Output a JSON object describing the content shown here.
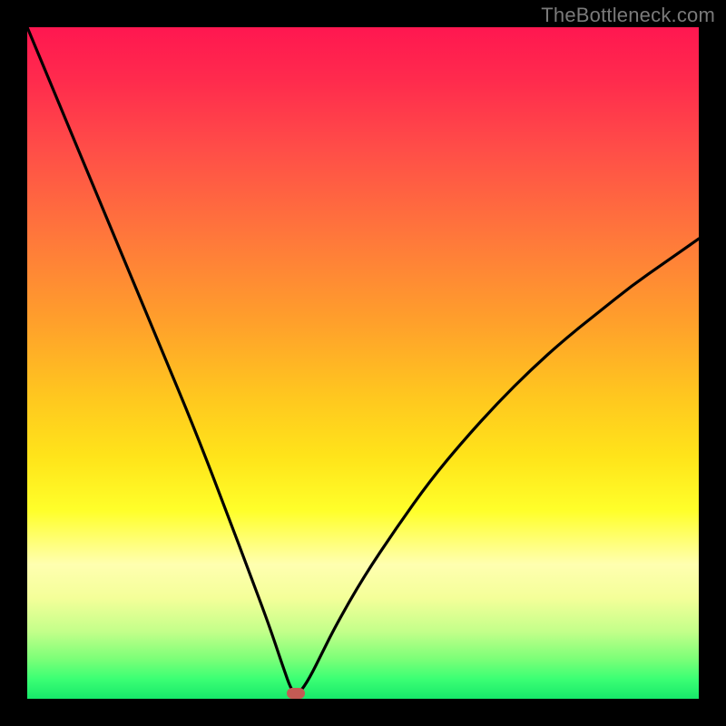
{
  "watermark": "TheBottleneck.com",
  "chart_data": {
    "type": "line",
    "title": "",
    "xlabel": "",
    "ylabel": "",
    "xlim": [
      0,
      1
    ],
    "ylim": [
      0,
      1
    ],
    "series": [
      {
        "name": "bottleneck-curve",
        "x": [
          0.0,
          0.05,
          0.1,
          0.15,
          0.2,
          0.25,
          0.3,
          0.33,
          0.36,
          0.38,
          0.395,
          0.405,
          0.42,
          0.44,
          0.46,
          0.5,
          0.55,
          0.6,
          0.65,
          0.7,
          0.75,
          0.8,
          0.85,
          0.9,
          0.95,
          1.0
        ],
        "y": [
          1.0,
          0.88,
          0.76,
          0.64,
          0.52,
          0.4,
          0.27,
          0.19,
          0.11,
          0.05,
          0.008,
          0.008,
          0.03,
          0.07,
          0.11,
          0.18,
          0.255,
          0.325,
          0.385,
          0.44,
          0.49,
          0.535,
          0.575,
          0.615,
          0.65,
          0.685
        ]
      }
    ],
    "marker": {
      "x": 0.4,
      "y": 0.008,
      "label": "optimal-point"
    },
    "gradient_stops": [
      {
        "pos": 0.0,
        "color": "#17e86a"
      },
      {
        "pos": 0.06,
        "color": "#7dff78"
      },
      {
        "pos": 0.15,
        "color": "#f4ff99"
      },
      {
        "pos": 0.28,
        "color": "#ffff2a"
      },
      {
        "pos": 0.45,
        "color": "#ffc71f"
      },
      {
        "pos": 0.68,
        "color": "#ff7a3a"
      },
      {
        "pos": 0.92,
        "color": "#ff2b4d"
      },
      {
        "pos": 1.0,
        "color": "#ff1750"
      }
    ]
  }
}
